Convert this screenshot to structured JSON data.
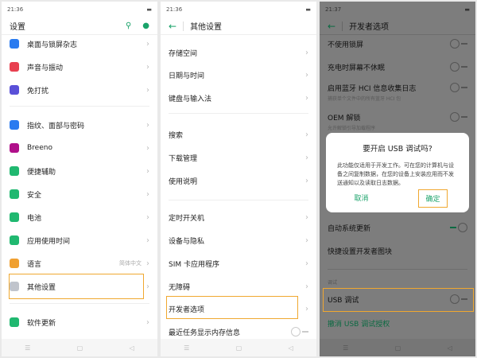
{
  "panel1": {
    "time": "21:36",
    "title": "设置",
    "items": [
      {
        "label": "桌面与锁屏杂志",
        "color": "#2a7bf0"
      },
      {
        "label": "声音与振动",
        "color": "#e84050"
      },
      {
        "label": "免打扰",
        "color": "#5a50d8"
      },
      {
        "label": "指纹、面部与密码",
        "color": "#2a7bf0"
      },
      {
        "label": "Breeno",
        "color": "#b0108a"
      },
      {
        "label": "便捷辅助",
        "color": "#20b870"
      },
      {
        "label": "安全",
        "color": "#20b870"
      },
      {
        "label": "电池",
        "color": "#20b870"
      },
      {
        "label": "应用使用时间",
        "color": "#20b870"
      },
      {
        "label": "语言",
        "color": "#f0a030",
        "value": "简体中文"
      },
      {
        "label": "其他设置",
        "color": "#c0c4cc"
      },
      {
        "label": "软件更新",
        "color": "#20b870"
      }
    ]
  },
  "panel2": {
    "time": "21:36",
    "title": "其他设置",
    "items": [
      "存储空间",
      "日期与时间",
      "键盘与输入法",
      "搜索",
      "下载管理",
      "使用说明",
      "定时开关机",
      "设备与隐私",
      "SIM 卡应用程序",
      "无障碍",
      "开发者选项",
      "最近任务显示内存信息"
    ]
  },
  "panel3": {
    "time": "21:37",
    "title": "开发者选项",
    "items": [
      {
        "label": "不使用锁屏"
      },
      {
        "label": "充电时屏幕不休眠"
      },
      {
        "label": "启用蓝牙 HCI 信息收集日志",
        "sub": "捕获单个文件中的所有蓝牙 HCI 包"
      },
      {
        "label": "OEM 解锁",
        "sub": "允许解锁引导加载程序"
      }
    ],
    "auto_update": "自动系统更新",
    "quick_tiles": "快捷设置开发者图块",
    "section": "调试",
    "usb_debug": "USB 调试",
    "revoke": "撤消 USB 调试授权",
    "dialog": {
      "title": "要开启 USB 调试吗?",
      "body": "此功能仅适用于开发工作。可在您的计算机与设备之间复制数据，在您的设备上安装应用而不发送通知以及读取日志数据。",
      "cancel": "取消",
      "ok": "确定"
    }
  },
  "nav": {
    "menu": "☰",
    "home": "▢",
    "back": "◁"
  }
}
